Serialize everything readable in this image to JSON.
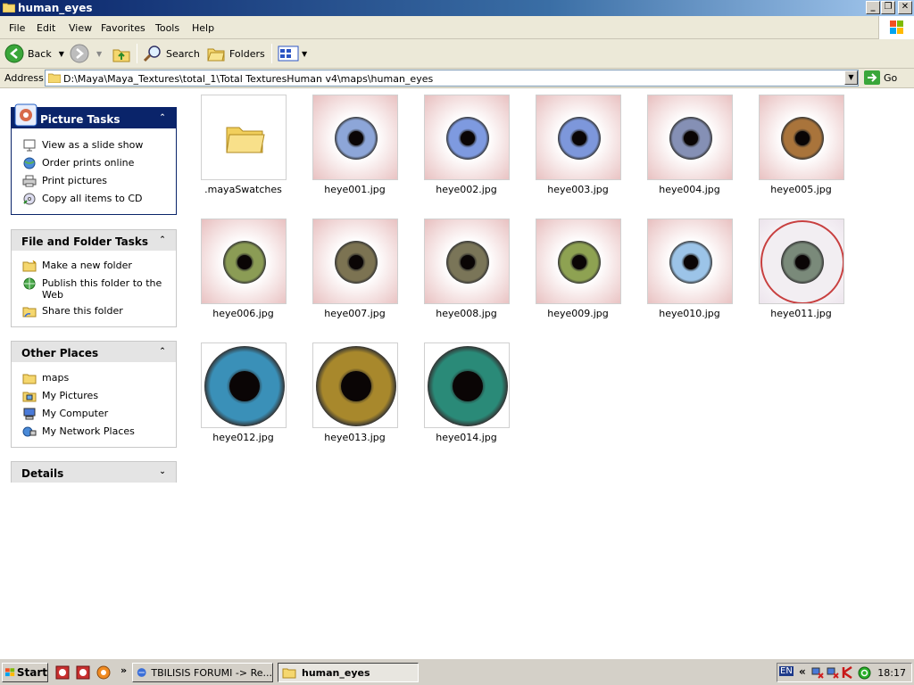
{
  "window": {
    "title": "human_eyes"
  },
  "menu": [
    "File",
    "Edit",
    "View",
    "Favorites",
    "Tools",
    "Help"
  ],
  "toolbar": {
    "back": "Back",
    "search": "Search",
    "folders": "Folders"
  },
  "address": {
    "label": "Address",
    "path": "D:\\Maya\\Maya_Textures\\total_1\\Total TexturesHuman v4\\maps\\human_eyes",
    "go": "Go"
  },
  "panels": {
    "picture_tasks": {
      "title": "Picture Tasks",
      "items": [
        "View as a slide show",
        "Order prints online",
        "Print pictures",
        "Copy all items to CD"
      ]
    },
    "file_folder_tasks": {
      "title": "File and Folder Tasks",
      "items": [
        "Make a new folder",
        "Publish this folder to the Web",
        "Share this folder"
      ]
    },
    "other_places": {
      "title": "Other Places",
      "items": [
        "maps",
        "My Pictures",
        "My Computer",
        "My Network Places"
      ]
    },
    "details": {
      "title": "Details"
    }
  },
  "files": [
    {
      "name": ".mayaSwatches",
      "kind": "folder"
    },
    {
      "name": "heye001.jpg",
      "iris": "#8da6d8",
      "sclera": "#e8c0c0"
    },
    {
      "name": "heye002.jpg",
      "iris": "#7e9ae0",
      "sclera": "#e8c0c0"
    },
    {
      "name": "heye003.jpg",
      "iris": "#7d97db",
      "sclera": "#e8c0c0"
    },
    {
      "name": "heye004.jpg",
      "iris": "#8590b5",
      "sclera": "#e8c0c0"
    },
    {
      "name": "heye005.jpg",
      "iris": "#a9743b",
      "sclera": "#e8c0c0"
    },
    {
      "name": "heye006.jpg",
      "iris": "#8b9c55",
      "sclera": "#e8c0c0"
    },
    {
      "name": "heye007.jpg",
      "iris": "#7c7352",
      "sclera": "#e8c0c0"
    },
    {
      "name": "heye008.jpg",
      "iris": "#7a7558",
      "sclera": "#e8c0c0"
    },
    {
      "name": "heye009.jpg",
      "iris": "#8ea252",
      "sclera": "#e8c0c0"
    },
    {
      "name": "heye010.jpg",
      "iris": "#9cc4e8",
      "sclera": "#e8c0c0"
    },
    {
      "name": "heye011.jpg",
      "iris": "#7a8a7a",
      "sclera": "#ece4ec"
    },
    {
      "name": "heye012.jpg",
      "iris": "#3a90b8",
      "sclera": "#ffffff"
    },
    {
      "name": "heye013.jpg",
      "iris": "#a8882c",
      "sclera": "#ffffff"
    },
    {
      "name": "heye014.jpg",
      "iris": "#2a8a78",
      "sclera": "#ffffff"
    }
  ],
  "taskbar": {
    "start": "Start",
    "tasks": [
      "TBILISIS FORUMI -> Re...",
      "human_eyes"
    ],
    "tray_lang": "EN",
    "clock": "18:17"
  }
}
